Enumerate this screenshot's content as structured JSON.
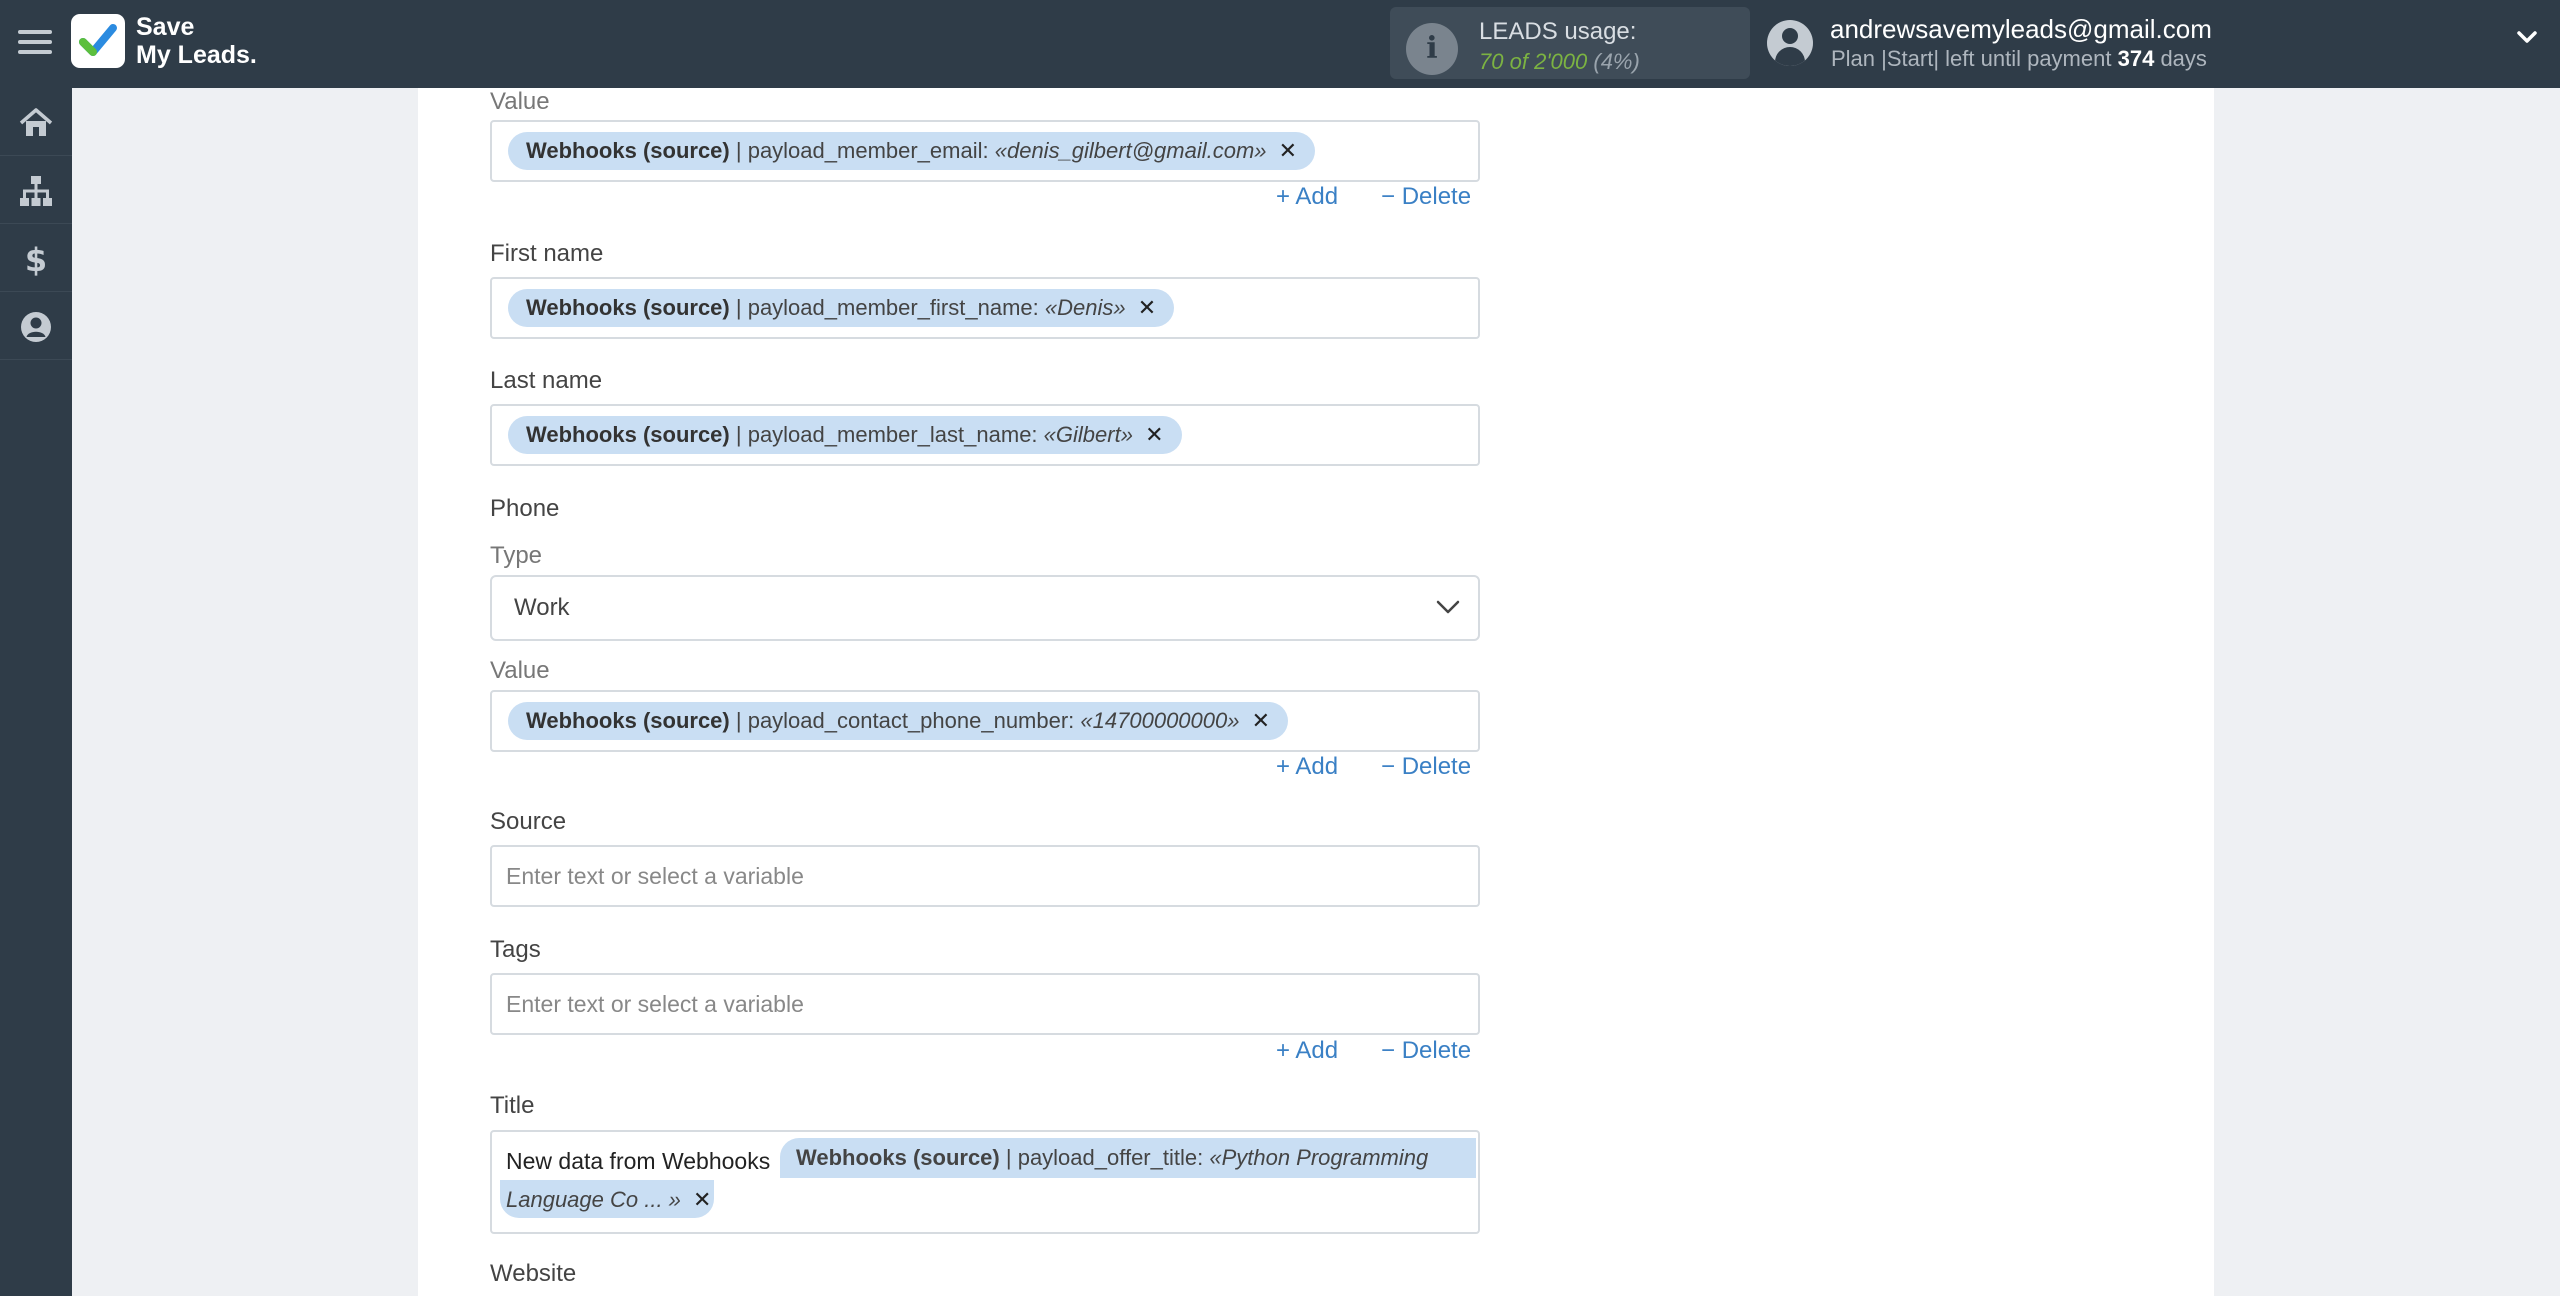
{
  "header": {
    "logo_line1": "Save",
    "logo_line2": "My Leads.",
    "usage_title": "LEADS usage:",
    "usage_used": "70",
    "usage_of": "of",
    "usage_total": "2'000",
    "usage_pct": "(4%)",
    "user_email": "andrewsavemyleads@gmail.com",
    "plan_prefix": "Plan |Start| left until payment",
    "plan_days": "374",
    "plan_suffix": "days"
  },
  "sidebar": {
    "items": [
      {
        "icon": "home-icon"
      },
      {
        "icon": "sitemap-icon"
      },
      {
        "icon": "dollar-icon"
      },
      {
        "icon": "user-circle-icon"
      }
    ]
  },
  "form": {
    "email_value_label": "Value",
    "email_tag": {
      "source": "Webhooks (source)",
      "field": "| payload_member_email:",
      "value": "«denis_gilbert@gmail.com»"
    },
    "add_label": "Add",
    "delete_label": "Delete",
    "first_name_label": "First name",
    "first_name_tag": {
      "source": "Webhooks (source)",
      "field": "| payload_member_first_name:",
      "value": "«Denis»"
    },
    "last_name_label": "Last name",
    "last_name_tag": {
      "source": "Webhooks (source)",
      "field": "| payload_member_last_name:",
      "value": "«Gilbert»"
    },
    "phone_label": "Phone",
    "phone_type_label": "Type",
    "phone_type_value": "Work",
    "phone_value_label": "Value",
    "phone_tag": {
      "source": "Webhooks (source)",
      "field": "| payload_contact_phone_number:",
      "value": "«14700000000»"
    },
    "source_label": "Source",
    "source_placeholder": "Enter text or select a variable",
    "tags_label": "Tags",
    "tags_placeholder": "Enter text or select a variable",
    "title_label": "Title",
    "title_text": "New data from Webhooks",
    "title_tag": {
      "source": "Webhooks (source)",
      "field": "| payload_offer_title:",
      "value_line1": "«Python Programming",
      "value_line2": "Language Co ... »"
    },
    "website_label": "Website"
  },
  "colors": {
    "header_bg": "#2f3c48",
    "tag_bg": "#c9def3",
    "link": "#3a80c5",
    "usage_green": "#7cb342"
  }
}
